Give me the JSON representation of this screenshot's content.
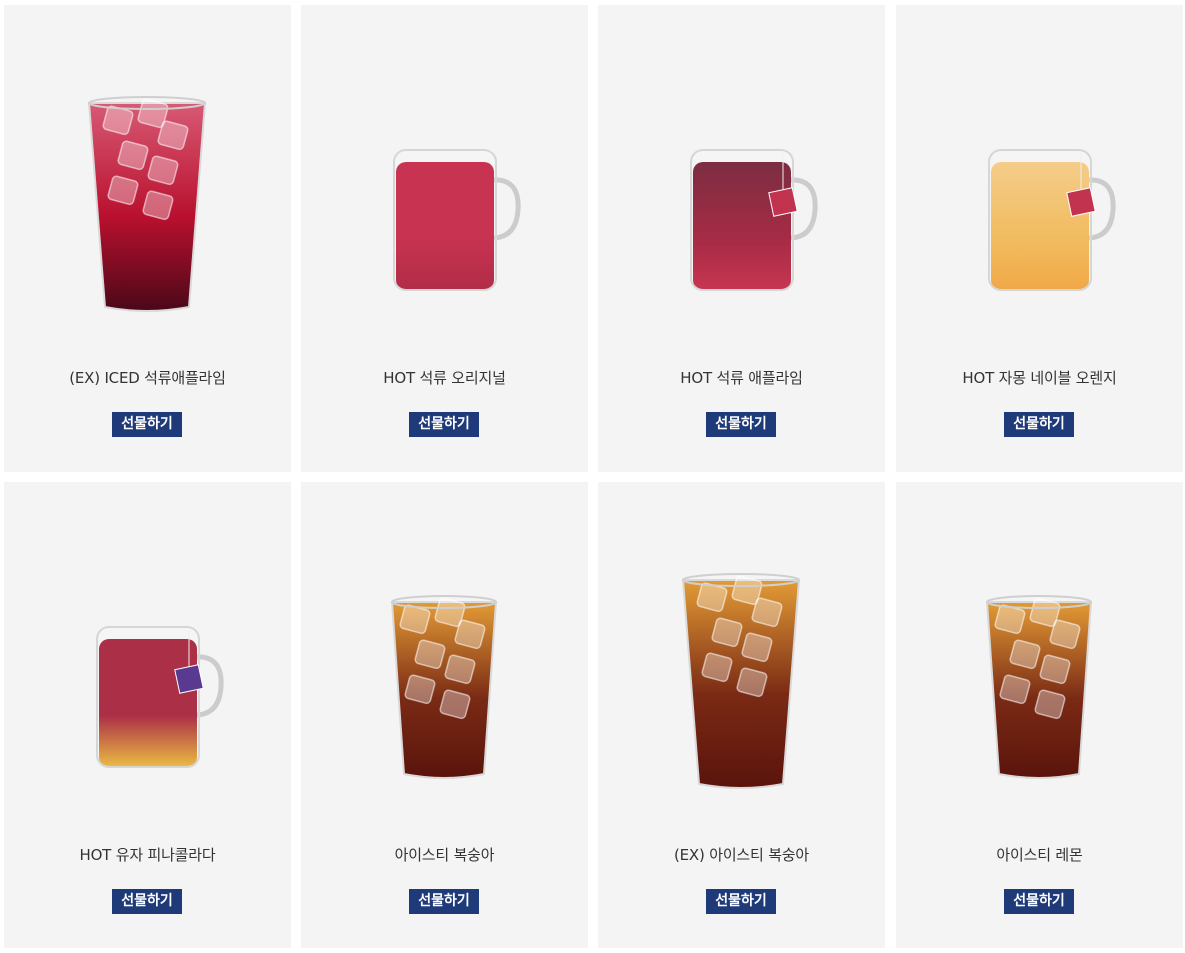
{
  "gift_label": "선물하기",
  "products": [
    {
      "name": "(EX) ICED 석류애플라임",
      "drink": "iced",
      "color": "#b8102e",
      "top": "#d85a74",
      "bottom": "#4a0818",
      "size": "large",
      "tag": false
    },
    {
      "name": "HOT 석류 오리지널",
      "drink": "mug",
      "color": "#c0173a",
      "top": "#c0173a",
      "bottom": "#a8102e",
      "size": "normal",
      "tag": false
    },
    {
      "name": "HOT 석류 애플라임",
      "drink": "mug",
      "color": "#9a0e2c",
      "top": "#6a1028",
      "bottom": "#c01a3a",
      "size": "normal",
      "tag": true,
      "tag_color": "#c2334f"
    },
    {
      "name": "HOT 자몽 네이블 오렌지",
      "drink": "mug",
      "color": "#f0b34a",
      "top": "#f3c67a",
      "bottom": "#ef9d2e",
      "size": "normal",
      "tag": true,
      "tag_color": "#c2334f"
    },
    {
      "name": "HOT 유자 피나콜라다",
      "drink": "mug",
      "color": "#a0142e",
      "top": "#a0142e",
      "bottom": "#e8b22a",
      "size": "normal",
      "tag": true,
      "tag_color": "#5a3a90"
    },
    {
      "name": "아이스티 복숭아",
      "drink": "iced",
      "color": "#7a2a14",
      "top": "#e39b35",
      "bottom": "#5a140c",
      "size": "normal",
      "tag": false
    },
    {
      "name": "(EX) 아이스티 복숭아",
      "drink": "iced",
      "color": "#7a2a14",
      "top": "#e39b35",
      "bottom": "#5a140c",
      "size": "large",
      "tag": false
    },
    {
      "name": "아이스티 레몬",
      "drink": "iced",
      "color": "#7a2a14",
      "top": "#e39b35",
      "bottom": "#5a140c",
      "size": "normal",
      "tag": false
    }
  ]
}
